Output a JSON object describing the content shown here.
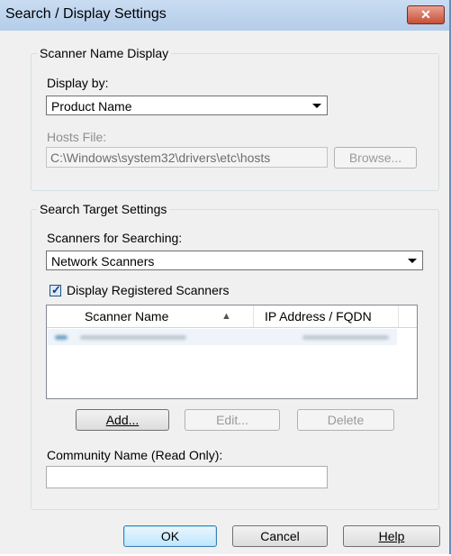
{
  "window": {
    "title": "Search / Display Settings",
    "close_glyph": "✕"
  },
  "scanner_name_display": {
    "legend": "Scanner Name Display",
    "display_by_label": "Display by:",
    "display_by_value": "Product Name",
    "hosts_file_label": "Hosts File:",
    "hosts_file_value": "C:\\Windows\\system32\\drivers\\etc\\hosts",
    "browse_label": "Browse..."
  },
  "search_target_settings": {
    "legend": "Search Target Settings",
    "scanners_label": "Scanners for Searching:",
    "scanners_value": "Network Scanners",
    "display_registered_label": "Display Registered Scanners",
    "display_registered_checked": true,
    "list": {
      "columns": [
        "Scanner Name",
        "IP Address / FQDN"
      ],
      "sort_indicator": "▲"
    },
    "add_label": "Add...",
    "edit_label": "Edit...",
    "delete_label": "Delete",
    "community_label": "Community Name (Read Only):",
    "community_value": ""
  },
  "footer": {
    "ok_label": "OK",
    "cancel_label": "Cancel",
    "help_label": "Help"
  }
}
